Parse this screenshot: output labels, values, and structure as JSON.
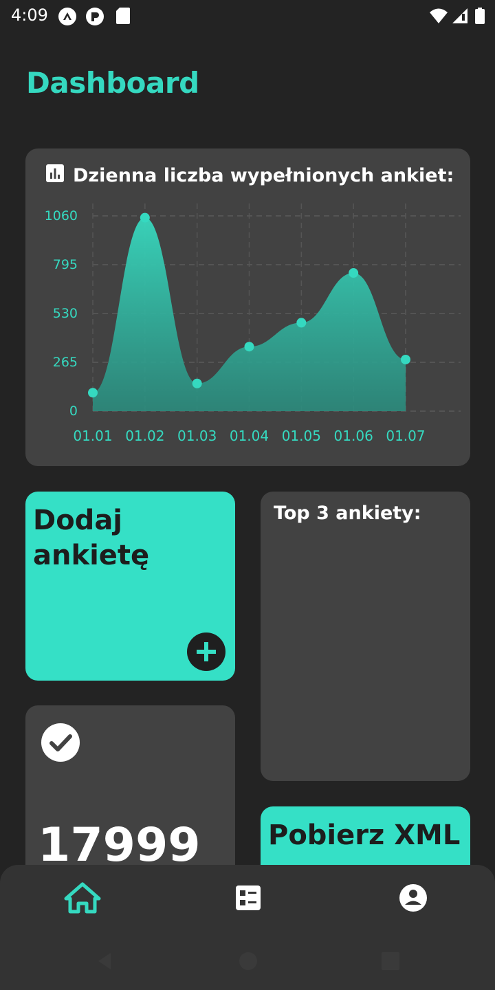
{
  "status_bar": {
    "time": "4:09",
    "left_icons": [
      "a-badge-icon",
      "p-badge-icon",
      "sd-card-icon"
    ],
    "right_icons": [
      "wifi-icon",
      "signal-icon",
      "battery-icon"
    ]
  },
  "page": {
    "title": "Dashboard"
  },
  "colors": {
    "accent": "#35d9c0",
    "tile_accent": "#35e0c6",
    "card": "#424242",
    "background": "#232323"
  },
  "chart": {
    "heading": "Dzienna liczba wypełnionych ankiet:",
    "heading_icon": "bar-chart-icon"
  },
  "chart_data": {
    "type": "area",
    "title": "Dzienna liczba wypełnionych ankiet:",
    "xlabel": "",
    "ylabel": "",
    "x": [
      "01.01",
      "01.02",
      "01.03",
      "01.04",
      "01.05",
      "01.06",
      "01.07"
    ],
    "series": [
      {
        "values": [
          100,
          1050,
          150,
          350,
          480,
          750,
          280
        ]
      }
    ],
    "y_ticks": [
      0,
      265,
      530,
      795,
      1060
    ],
    "ylim": [
      0,
      1060
    ],
    "grid": true,
    "grid_style": "dashed",
    "smooth": true,
    "legend": "none"
  },
  "tiles": {
    "add_survey": {
      "label": "Dodaj ankietę",
      "icon": "add-circle-icon"
    },
    "top_surveys": {
      "label": "Top 3 ankiety:"
    },
    "completed": {
      "icon": "check-circle-icon",
      "value": "17999"
    },
    "download_xml": {
      "label": "Pobierz XML"
    }
  },
  "bottom_nav": {
    "items": [
      {
        "icon": "home-icon",
        "active": true
      },
      {
        "icon": "list-icon",
        "active": false
      },
      {
        "icon": "account-icon",
        "active": false
      }
    ]
  },
  "system_nav": [
    "back-icon",
    "home-circle-icon",
    "recents-icon"
  ]
}
